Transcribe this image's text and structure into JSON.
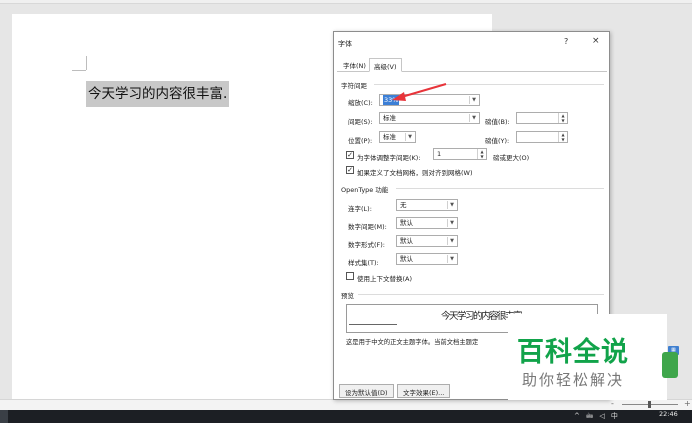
{
  "document": {
    "text": "今天学习的内容很丰富."
  },
  "dialog": {
    "title": "字体",
    "help": "?",
    "close": "×",
    "tabs": [
      {
        "label": "字体(N)"
      },
      {
        "label": "高级(V)"
      }
    ],
    "char_spacing": {
      "section": "字符间距",
      "scale_label": "缩放(C):",
      "scale_value": "33%",
      "spacing_label": "间距(S):",
      "spacing_value": "标准",
      "spacing_by_label": "磅值(B):",
      "position_label": "位置(P):",
      "position_value": "标准",
      "position_by_label": "磅值(Y):",
      "kerning_label": "为字体调整字间距(K):",
      "kerning_value": "1",
      "kerning_suffix": "磅或更大(O)",
      "grid_label": "如果定义了文档网格，则对齐到网格(W)"
    },
    "opentype": {
      "section": "OpenType 功能",
      "ligatures_label": "连字(L):",
      "ligatures_value": "无",
      "number_spacing_label": "数字间距(M):",
      "number_spacing_value": "默认",
      "number_forms_label": "数字形式(F):",
      "number_forms_value": "默认",
      "stylistic_sets_label": "样式集(T):",
      "stylistic_sets_value": "默认",
      "contextual_label": "使用上下文替换(A)"
    },
    "preview": {
      "section": "预览",
      "sample": "今天学习的内容很丰富",
      "note": "这是用于中文的正文主题字体。当前文档主题定"
    },
    "footer": {
      "set_default": "设为默认值(D)",
      "text_effects": "文字效果(E)..."
    }
  },
  "watermark": {
    "title": "百科全说",
    "subtitle": "助你轻松解决"
  },
  "taskbar": {
    "tray": "^ 🖮 ◁ 中",
    "clock": "22:46"
  },
  "statusbar": {
    "zoom_minus": "-",
    "zoom_plus": "+"
  },
  "colors": {
    "watermark_green": "#11a34a",
    "selection_blue": "#3c7fd6",
    "arrow_red": "#e8343a"
  }
}
